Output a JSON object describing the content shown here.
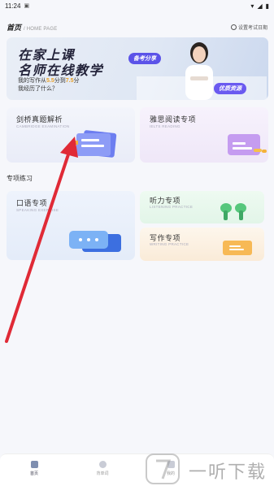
{
  "status_bar": {
    "time": "11:24"
  },
  "header": {
    "title": "首页",
    "subtitle": "/ HOME PAGE",
    "exam_date": "设置考试日期"
  },
  "banner": {
    "title_line1": "在家上课",
    "title_line2": "名师在线教学",
    "line1_prefix": "我的写作从",
    "score_from": "5.5",
    "line1_mid": "分到",
    "score_to": "7.5",
    "line1_suffix": "分",
    "line2": "我经历了什么？",
    "tag1": "备考分享",
    "tag2": "优质资源"
  },
  "cards": {
    "cambridge": {
      "title": "剑桥真题解析",
      "subtitle": "CAMBRIDGE EXAMINATION"
    },
    "ielts": {
      "title": "雅思阅读专项",
      "subtitle": "IELTS READING"
    },
    "speaking": {
      "title": "口语专项",
      "subtitle": "SPEAKING EXERCISE"
    },
    "listening": {
      "title": "听力专项",
      "subtitle": "LISTENING PRACTICE"
    },
    "writing": {
      "title": "写作专项",
      "subtitle": "WRITING PRACTICE"
    }
  },
  "section": {
    "title": "专项练习"
  },
  "bottom_nav": {
    "home": "首页",
    "vocab": "背单词",
    "mine": "我的"
  },
  "watermark": {
    "text": "一听下载"
  },
  "colors": {
    "arrow": "#e02a36",
    "accent": "#5b53e8",
    "highlight": "#e8a028"
  }
}
